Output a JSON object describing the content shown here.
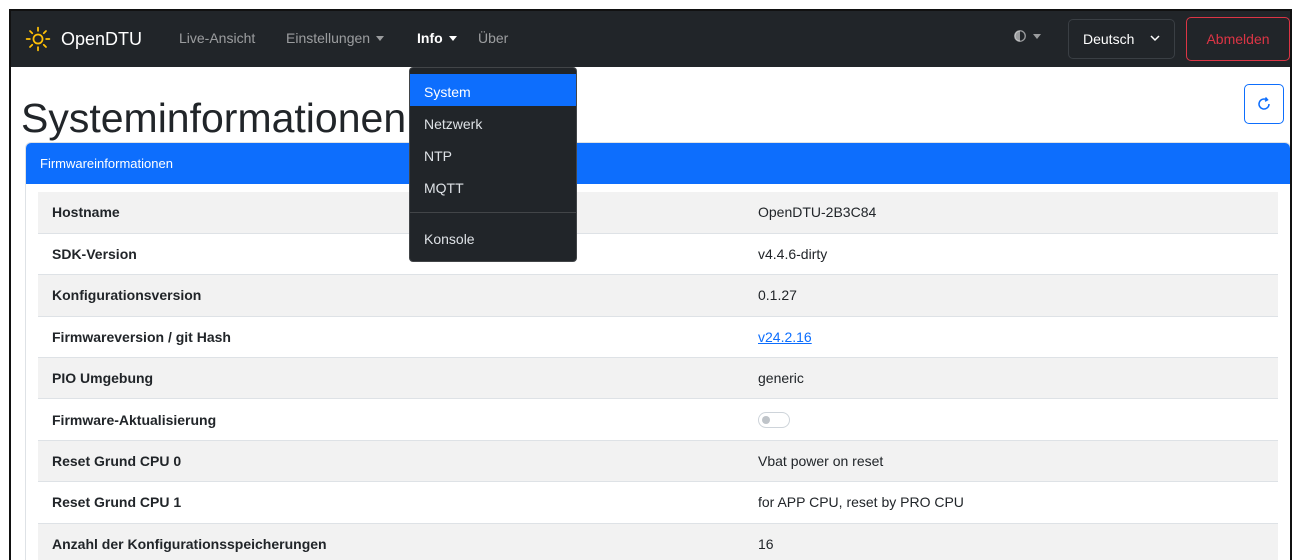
{
  "navbar": {
    "brand": "OpenDTU",
    "links": {
      "live": "Live-Ansicht",
      "settings": "Einstellungen",
      "info": "Info",
      "about": "Über"
    },
    "language": "Deutsch",
    "logout": "Abmelden"
  },
  "info_menu": {
    "items": [
      "System",
      "Netzwerk",
      "NTP",
      "MQTT"
    ],
    "console": "Konsole",
    "active": "System"
  },
  "page": {
    "title": "Systeminformationen"
  },
  "firmware_card": {
    "header": "Firmwareinformationen",
    "rows": [
      {
        "key": "Hostname",
        "value": "OpenDTU-2B3C84"
      },
      {
        "key": "SDK-Version",
        "value": "v4.4.6-dirty"
      },
      {
        "key": "Konfigurationsversion",
        "value": "0.1.27"
      },
      {
        "key": "Firmwareversion / git Hash",
        "value": "v24.2.16"
      },
      {
        "key": "PIO Umgebung",
        "value": "generic"
      },
      {
        "key": "Firmware-Aktualisierung",
        "value": ""
      },
      {
        "key": "Reset Grund CPU 0",
        "value": "Vbat power on reset"
      },
      {
        "key": "Reset Grund CPU 1",
        "value": "for APP CPU, reset by PRO CPU"
      },
      {
        "key": "Anzahl der Konfigurationsspeicherungen",
        "value": "16"
      }
    ]
  },
  "colors": {
    "navbar_bg": "#212529",
    "accent": "#0d6efd",
    "danger": "#dc3545",
    "brand_icon": "#ffc107"
  },
  "icons": {
    "brand": "sun-icon",
    "theme": "half-circle-icon",
    "language": "chevron-down-icon",
    "reload": "reload-icon"
  }
}
